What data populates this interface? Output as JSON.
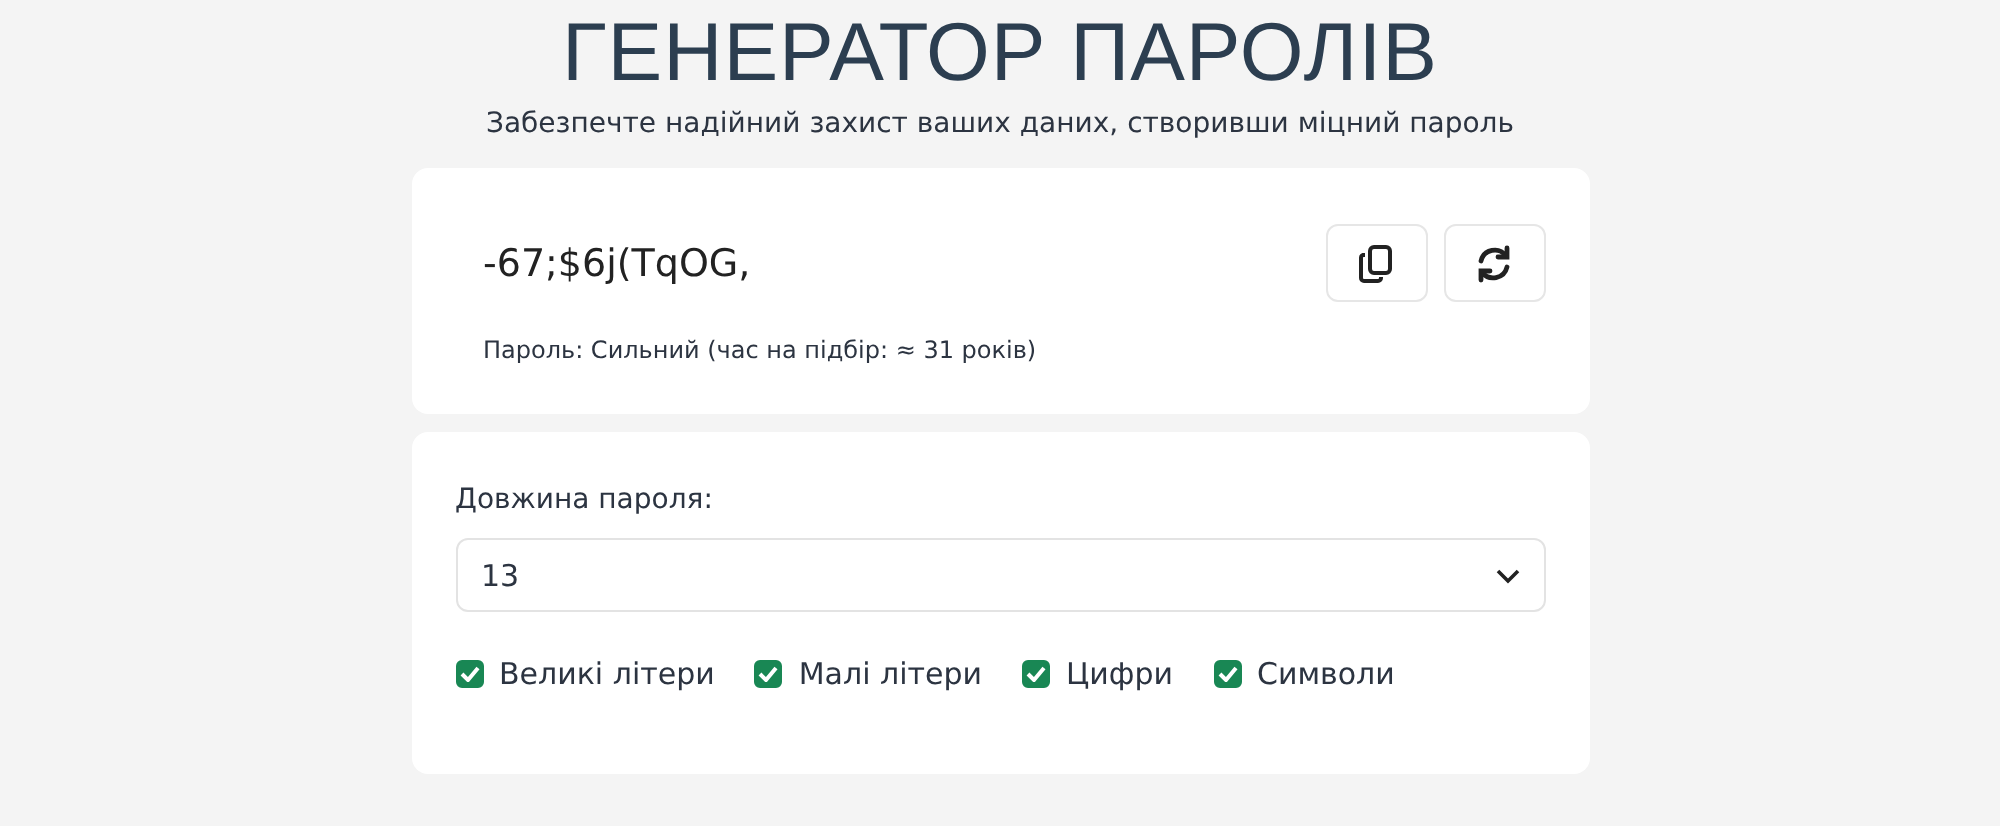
{
  "header": {
    "title": "ГЕНЕРАТОР ПАРОЛІВ",
    "subtitle": "Забезпечте надійний захист ваших даних, створивши міцний пароль"
  },
  "result": {
    "password": "-67;$6j(TqOG,",
    "strength": "Пароль: Сильний (час на підбір: ≈ 31 років)"
  },
  "settings": {
    "length_label": "Довжина пароля:",
    "length_value": "13",
    "options": [
      {
        "label": "Великі літери",
        "checked": true
      },
      {
        "label": "Малі літери",
        "checked": true
      },
      {
        "label": "Цифри",
        "checked": true
      },
      {
        "label": "Символи",
        "checked": true
      }
    ]
  }
}
